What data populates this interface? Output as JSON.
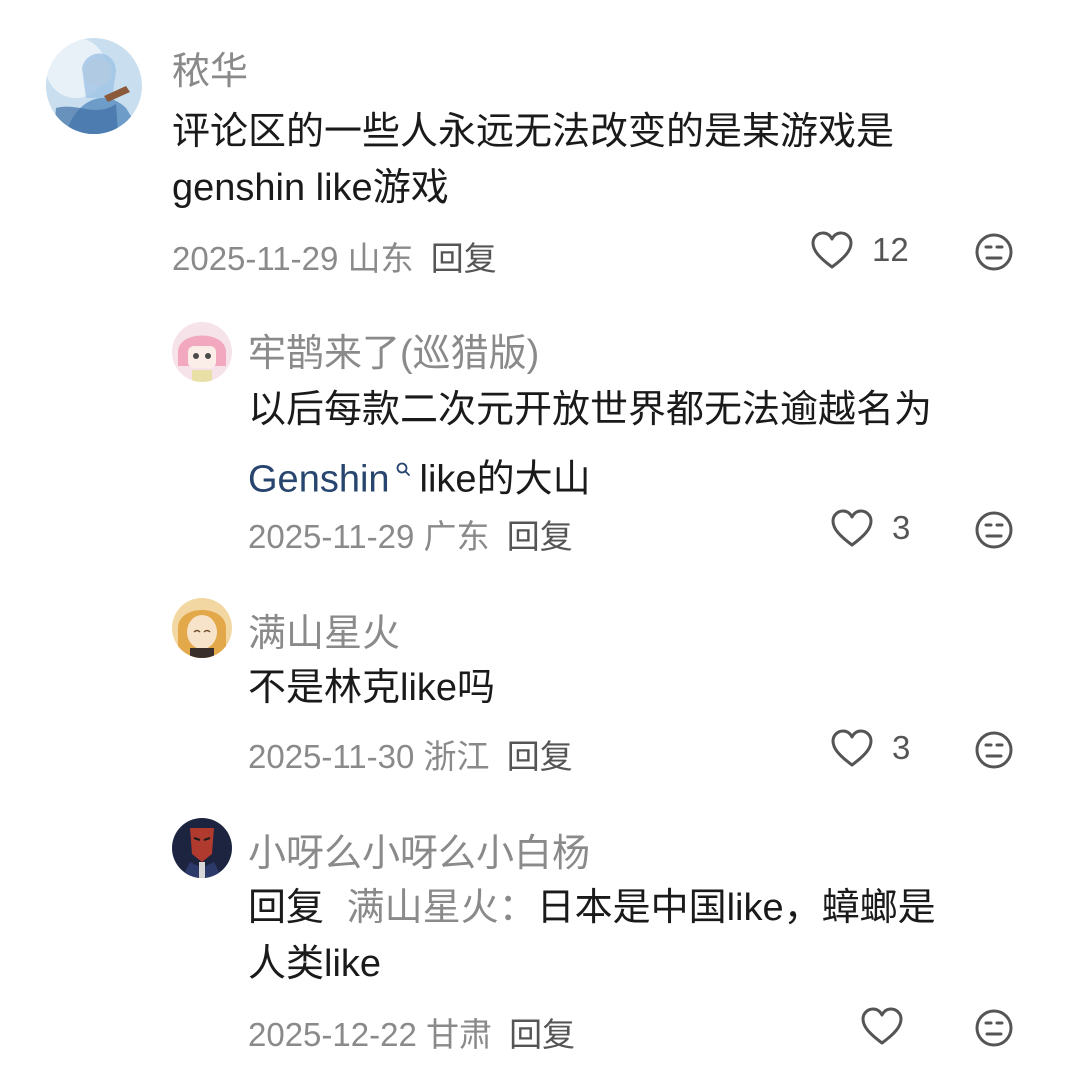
{
  "comments": [
    {
      "username": "秾华",
      "text_lines": [
        "评论区的一些人永远无法改变的是某游戏是",
        "genshin like游戏"
      ],
      "date": "2025-11-29",
      "location": "山东",
      "reply_label": "回复",
      "like_count": "12"
    },
    {
      "username": "牢鹊来了(巡猎版)",
      "text_line1": "以后每款二次元开放世界都无法逾越名为",
      "link_text": "Genshin",
      "text_line2_rest": "like的大山",
      "date": "2025-11-29",
      "location": "广东",
      "reply_label": "回复",
      "like_count": "3"
    },
    {
      "username": "满山星火",
      "text": "不是林克like吗",
      "date": "2025-11-30",
      "location": "浙江",
      "reply_label": "回复",
      "like_count": "3"
    },
    {
      "username": "小呀么小呀么小白杨",
      "reply_prefix": "回复",
      "reply_to": "满山星火：",
      "text_line1_rest": "日本是中国like，蟑螂是",
      "text_line2": "人类like",
      "date": "2025-12-22",
      "location": "甘肃",
      "reply_label": "回复"
    }
  ],
  "icons": {
    "like": "heart-outline-icon",
    "dislike": "sad-face-icon",
    "search": "search-icon"
  },
  "colors": {
    "link": "#27456e",
    "secondary_text": "#8a8a8a",
    "primary_text": "#1a1a1a"
  }
}
